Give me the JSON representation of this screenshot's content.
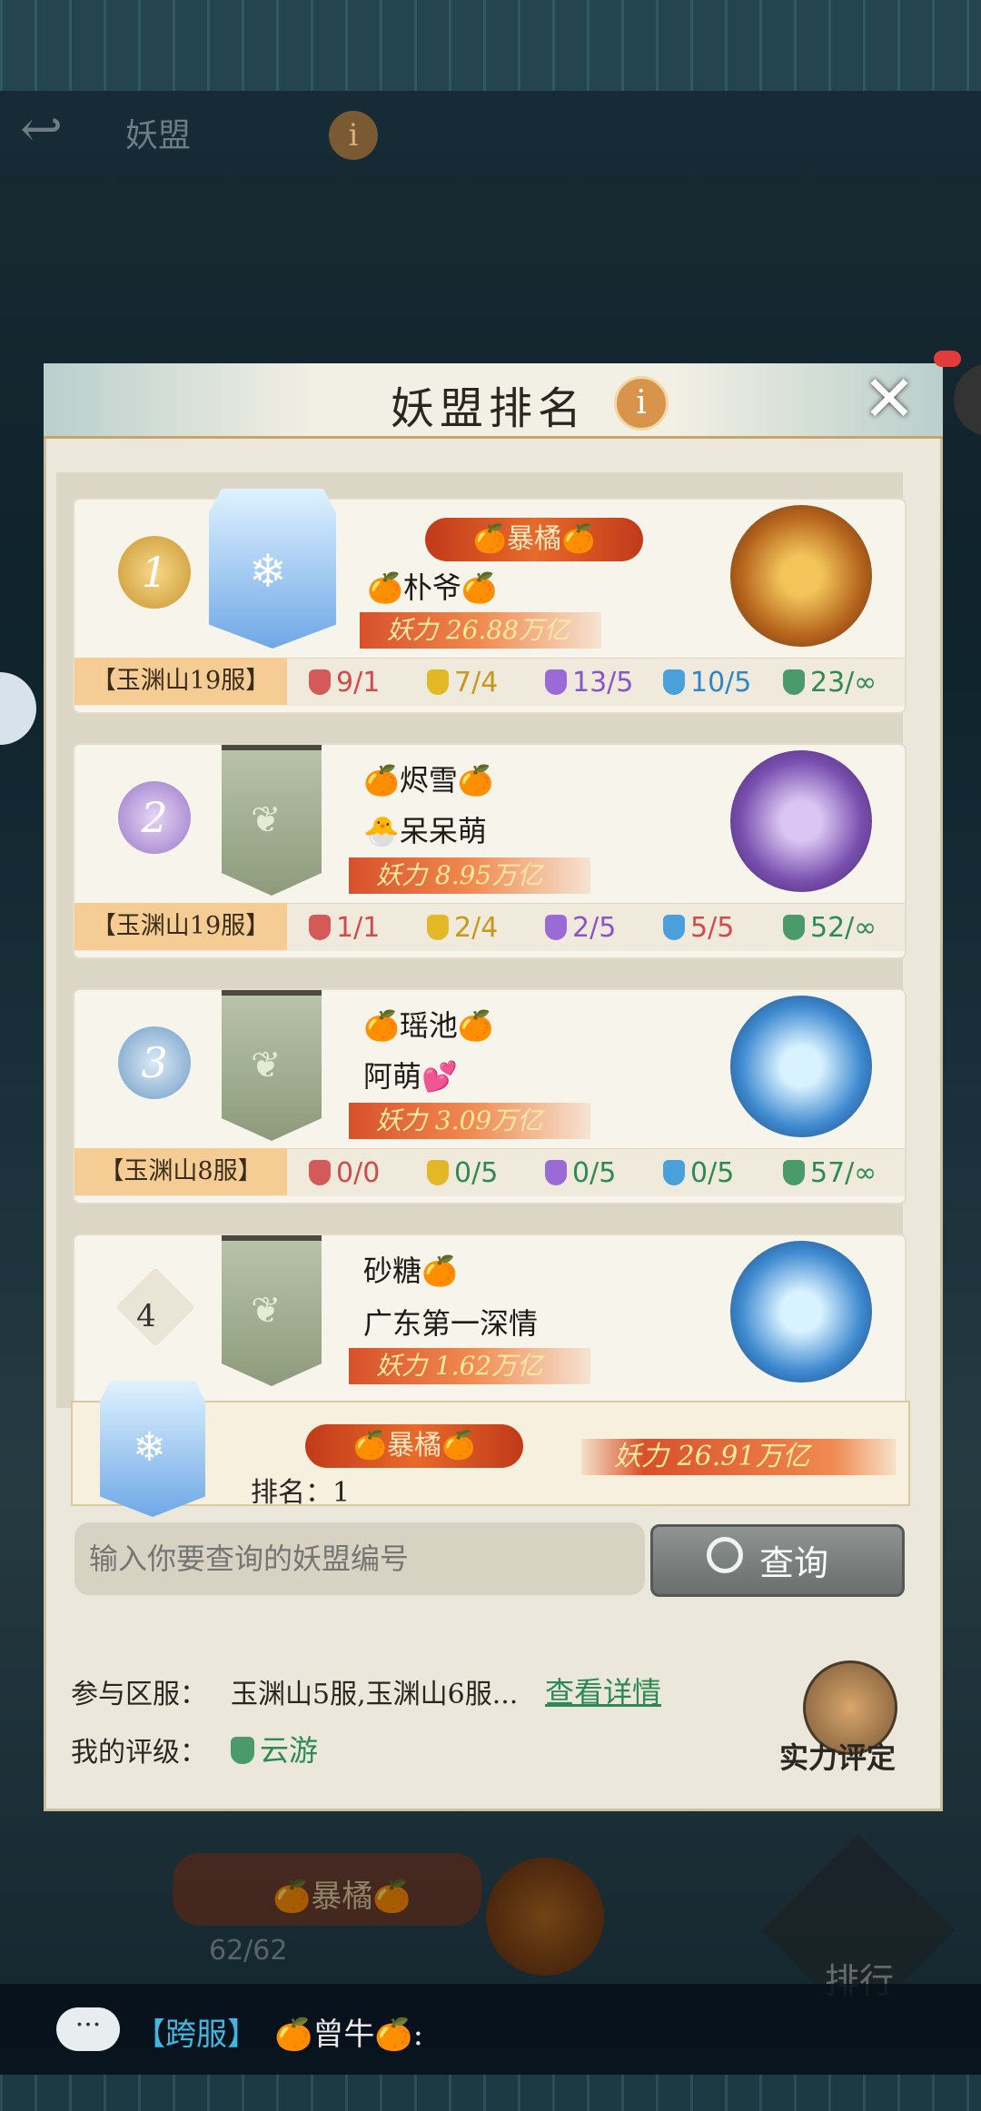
{
  "topbar": {
    "title": "妖盟",
    "info": "i"
  },
  "panel": {
    "title": "妖盟排名",
    "info": "i",
    "close": "✕"
  },
  "entries": [
    {
      "rank": "1",
      "tag": "🍊暴橘🍊",
      "line1": "🍊朴爷🍊",
      "line2": "",
      "power": "妖力 26.88万亿",
      "server": "【玉渊山19服】",
      "tiers": [
        "9/1",
        "7/4",
        "13/5",
        "10/5",
        "23/∞"
      ]
    },
    {
      "rank": "2",
      "tag": "",
      "line1": "🍊烬雪🍊",
      "line2": "🐣呆呆萌",
      "power": "妖力 8.95万亿",
      "server": "【玉渊山19服】",
      "tiers": [
        "1/1",
        "2/4",
        "2/5",
        "5/5",
        "52/∞"
      ]
    },
    {
      "rank": "3",
      "tag": "",
      "line1": "🍊瑶池🍊",
      "line2": "阿萌💕",
      "power": "妖力 3.09万亿",
      "server": "【玉渊山8服】",
      "tiers": [
        "0/0",
        "0/5",
        "0/5",
        "0/5",
        "57/∞"
      ]
    },
    {
      "rank": "4",
      "tag": "",
      "line1": "砂糖🍊",
      "line2": "广东第一深情",
      "power": "妖力 1.62万亿",
      "server": "",
      "tiers": []
    }
  ],
  "my_alliance": {
    "tag": "🍊暴橘🍊",
    "rank_text": "排名：1",
    "power": "妖力 26.91万亿"
  },
  "search": {
    "placeholder": "输入你要查询的妖盟编号",
    "button": "查询"
  },
  "info": {
    "servers_label": "参与区服：",
    "servers_value": "玉渊山5服,玉渊山6服...",
    "detail_link": "查看详情",
    "rating_label": "我的评级：",
    "rating_value": "云游"
  },
  "eval_button": "实力评定",
  "background": {
    "banner": "🍊暴橘🍊",
    "count": "62/62",
    "rank_label": "排行"
  },
  "chat": {
    "icon": "···",
    "tag": "【跨服】",
    "name": "🍊曾牛🍊:"
  },
  "colors": {
    "accent": "#d8944a",
    "green": "#2e8a55",
    "red": "#d44a4a"
  }
}
